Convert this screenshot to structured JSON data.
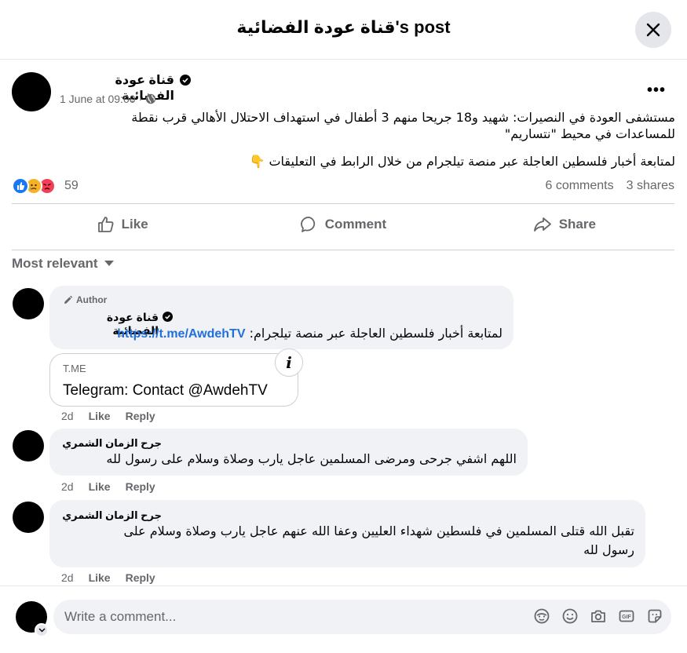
{
  "dialog": {
    "title": "قناة عودة الفضائية's post"
  },
  "post": {
    "author": "قناة عودة الفضائية",
    "time": "1 June at 09:00",
    "separator": "·",
    "line1": "مستشفى العودة في النصيرات: شهيد و18 جريحا منهم 3 أطفال في استهداف الاحتلال الأهالي قرب نقطة",
    "line2": "للمساعدات في محيط \"نتساريم\"",
    "line3": "لمتابعة أخبار فلسطين العاجلة عبر منصة تيلجرام من خلال الرابط في التعليقات 👇",
    "reaction_count": "59",
    "comments_count": "6 comments",
    "shares_count": "3 shares"
  },
  "actions": {
    "like": "Like",
    "comment": "Comment",
    "share": "Share"
  },
  "sort_label": "Most relevant",
  "comments": [
    {
      "badge": "Author",
      "name": "قناة عودة الفضائية",
      "text": "لمتابعة أخبار فلسطين العاجلة عبر منصة تيلجرام:",
      "link": "https://t.me/AwdehTV",
      "card_domain": "T.ME",
      "card_title": "Telegram: Contact @AwdehTV",
      "time": "2d",
      "like": "Like",
      "reply": "Reply"
    },
    {
      "name": "جرح الزمان الشمري",
      "text": "اللهم اشفي جرحى ومرضى المسلمين عاجل يارب وصلاة وسلام على رسول لله",
      "time": "2d",
      "like": "Like",
      "reply": "Reply"
    },
    {
      "name": "جرح الزمان الشمري",
      "line1": "تقبل الله قتلى المسلمين في فلسطين شهداء العليين وعفا الله عنهم عاجل يارب وصلاة وسلام على",
      "line2": "رسول لله",
      "time": "2d",
      "like": "Like",
      "reply": "Reply"
    }
  ],
  "composer": {
    "placeholder": "Write a comment..."
  },
  "colors": {
    "like_blue": "#1877f2",
    "link_blue": "#216fdb",
    "angry_red": "#f33e58",
    "sad_yellow": "#f7b125"
  }
}
